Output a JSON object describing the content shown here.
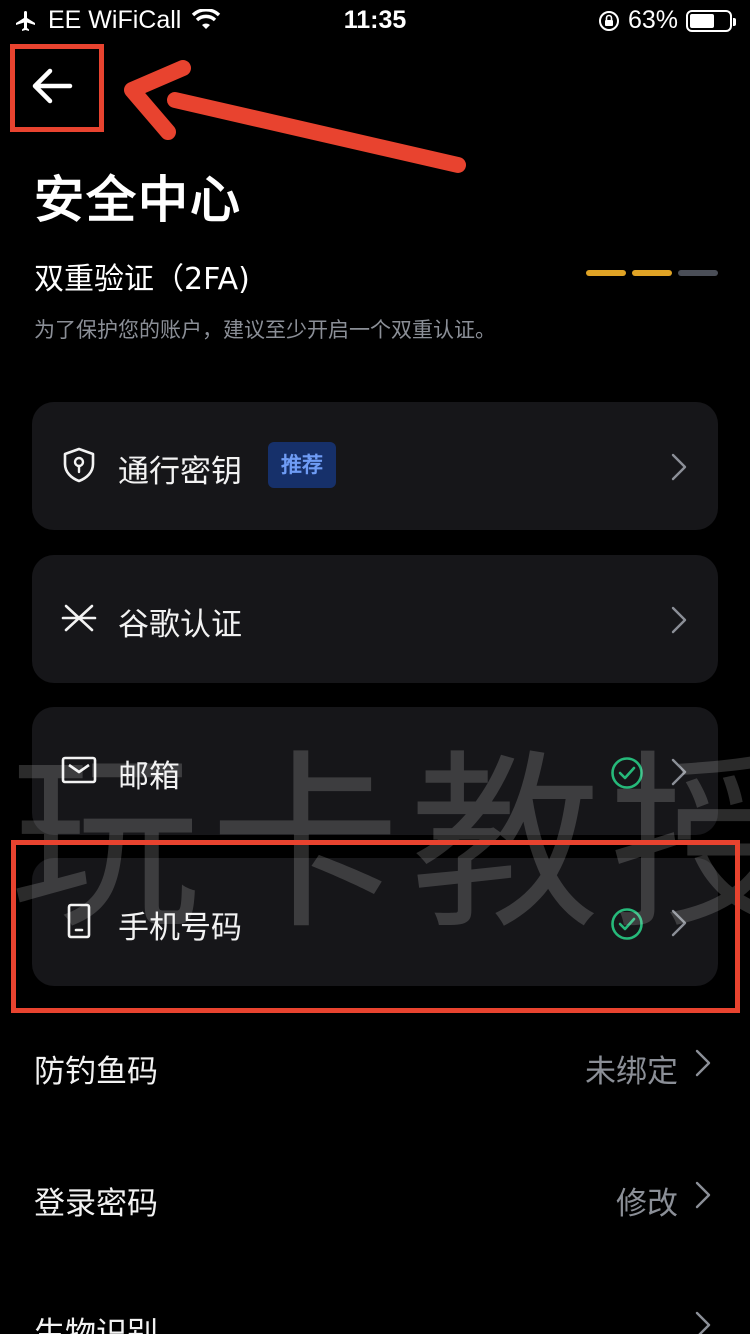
{
  "status_bar": {
    "carrier": "EE WiFiCall",
    "time": "11:35",
    "battery_percent": "63%",
    "battery_level": 0.63
  },
  "page_title": "安全中心",
  "two_factor": {
    "title": "双重验证（2FA)",
    "description": "为了保护您的账户，建议至少开启一个双重认证。",
    "progress_segments": [
      true,
      true,
      false
    ]
  },
  "methods": [
    {
      "label": "通行密钥",
      "badge": "推荐",
      "icon": "shield-key-icon",
      "verified": false
    },
    {
      "label": "谷歌认证",
      "icon": "authenticator-icon",
      "verified": false
    },
    {
      "label": "邮箱",
      "icon": "mail-icon",
      "verified": true
    },
    {
      "label": "手机号码",
      "icon": "phone-icon",
      "verified": true
    }
  ],
  "settings_rows": [
    {
      "label": "防钓鱼码",
      "value": "未绑定"
    },
    {
      "label": "登录密码",
      "value": "修改"
    },
    {
      "label": "生物识别",
      "value": ""
    }
  ],
  "watermark": "玩卡教授",
  "colors": {
    "background": "#000000",
    "card": "#161619",
    "accent_gold": "#e0a325",
    "badge_bg": "#16306a",
    "badge_text": "#6f9cf5",
    "check_green": "#26b97a",
    "annotation_red": "#e8432f"
  }
}
